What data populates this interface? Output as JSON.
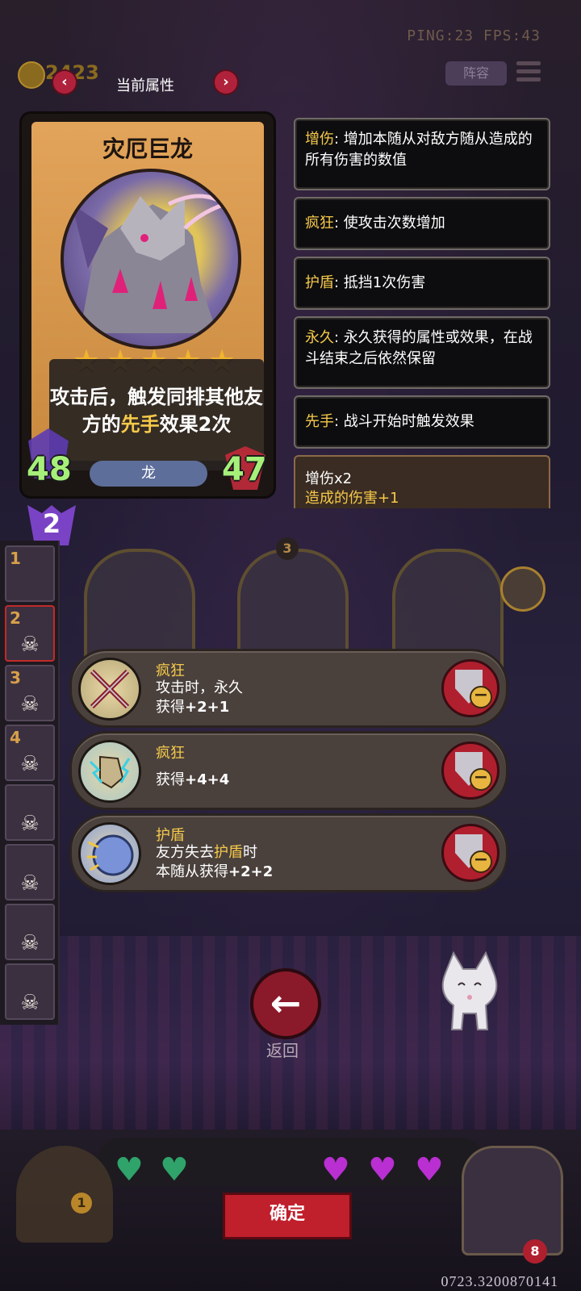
{
  "hud": {
    "ping_fps": "PING:23   FPS:43",
    "coins": "2423",
    "lineup_label": "阵容",
    "page_title": "当前属性"
  },
  "card": {
    "name": "灾厄巨龙",
    "stars": 5,
    "desc_part1": "攻击后，触发同排其他友方的",
    "desc_highlight": "先手",
    "desc_part2": "效果2次",
    "tribe": "龙",
    "attack": "48",
    "health": "47",
    "tier": "2"
  },
  "keywords": [
    {
      "name": "增伤",
      "text": ": 增加本随从对敌方随从造成的所有伤害的数值"
    },
    {
      "name": "疯狂",
      "text": ": 使攻击次数增加"
    },
    {
      "name": "护盾",
      "text": ": 抵挡1次伤害"
    },
    {
      "name": "永久",
      "text": ": 永久获得的属性或效果，在战斗结束之后依然保留"
    },
    {
      "name": "先手",
      "text": ": 战斗开始时触发效果"
    }
  ],
  "buff_summary": {
    "line1": "增伤x2",
    "line2": "造成的伤害+1"
  },
  "team_rail": [
    "1",
    "2",
    "3",
    "4",
    "",
    "",
    "",
    ""
  ],
  "board": {
    "slot_number": "3"
  },
  "effects": [
    {
      "name": "疯狂",
      "line1": "攻击时，永久",
      "line2_prefix": "获得",
      "line2_value": "+2+1",
      "icon": "crossed-swords-icon"
    },
    {
      "name": "疯狂",
      "line1": "",
      "line2_prefix": "获得",
      "line2_value": "+4+4",
      "icon": "lightning-fist-icon"
    },
    {
      "name": "护盾",
      "line1_prefix": "友方失去",
      "line1_hl": "护盾",
      "line1_suffix": "时",
      "line2_prefix": "本随从获得",
      "line2_value": "+2+2",
      "icon": "shield-orb-icon"
    }
  ],
  "bottom": {
    "back_label": "返回",
    "confirm_label": "确定",
    "barrel_count": "1",
    "hero_count": "8",
    "build_id": "0723.3200870141"
  },
  "colors": {
    "keyword": "#f5c94a",
    "stat_green": "#a6f07a",
    "button_red": "#c01f2c",
    "heart_green": "#2fa36a",
    "heart_purple": "#b92fd1"
  }
}
